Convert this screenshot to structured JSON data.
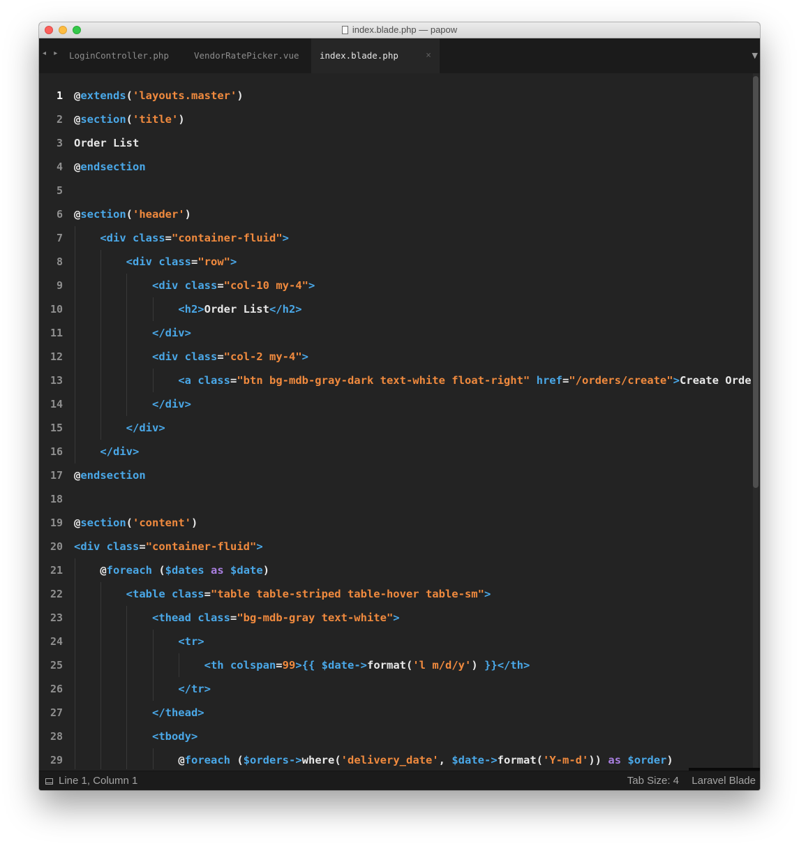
{
  "window": {
    "title": "index.blade.php — papow"
  },
  "tabs": [
    {
      "label": "LoginController.php",
      "active": false
    },
    {
      "label": "VendorRatePicker.vue",
      "active": false
    },
    {
      "label": "index.blade.php",
      "active": true
    }
  ],
  "tab_controls": {
    "nav_arrows": "◂ ▸",
    "close": "×",
    "menu": "▼"
  },
  "editor": {
    "current_line": 1,
    "lines": [
      {
        "n": "1",
        "tokens": [
          [
            "at",
            "@"
          ],
          [
            "dir",
            "extends"
          ],
          [
            "punct",
            "("
          ],
          [
            "str",
            "'layouts.master'"
          ],
          [
            "punct",
            ")"
          ]
        ]
      },
      {
        "n": "2",
        "tokens": [
          [
            "at",
            "@"
          ],
          [
            "dir",
            "section"
          ],
          [
            "punct",
            "("
          ],
          [
            "str",
            "'title'"
          ],
          [
            "punct",
            ")"
          ]
        ]
      },
      {
        "n": "3",
        "tokens": [
          [
            "text",
            "Order List"
          ]
        ]
      },
      {
        "n": "4",
        "tokens": [
          [
            "at",
            "@"
          ],
          [
            "dir",
            "endsection"
          ]
        ]
      },
      {
        "n": "5",
        "tokens": []
      },
      {
        "n": "6",
        "tokens": [
          [
            "at",
            "@"
          ],
          [
            "dir",
            "section"
          ],
          [
            "punct",
            "("
          ],
          [
            "str",
            "'header'"
          ],
          [
            "punct",
            ")"
          ]
        ]
      },
      {
        "n": "7",
        "tokens": [
          [
            "ws",
            "    "
          ],
          [
            "tag",
            "<div "
          ],
          [
            "attr",
            "class"
          ],
          [
            "punct",
            "="
          ],
          [
            "str",
            "\"container-fluid\""
          ],
          [
            "tag",
            ">"
          ]
        ]
      },
      {
        "n": "8",
        "tokens": [
          [
            "ws",
            "        "
          ],
          [
            "tag",
            "<div "
          ],
          [
            "attr",
            "class"
          ],
          [
            "punct",
            "="
          ],
          [
            "str",
            "\"row\""
          ],
          [
            "tag",
            ">"
          ]
        ]
      },
      {
        "n": "9",
        "tokens": [
          [
            "ws",
            "            "
          ],
          [
            "tag",
            "<div "
          ],
          [
            "attr",
            "class"
          ],
          [
            "punct",
            "="
          ],
          [
            "str",
            "\"col-10 my-4\""
          ],
          [
            "tag",
            ">"
          ]
        ]
      },
      {
        "n": "10",
        "tokens": [
          [
            "ws",
            "                "
          ],
          [
            "tag",
            "<h2>"
          ],
          [
            "text",
            "Order List"
          ],
          [
            "tag",
            "</h2>"
          ]
        ]
      },
      {
        "n": "11",
        "tokens": [
          [
            "ws",
            "            "
          ],
          [
            "tag",
            "</div>"
          ]
        ]
      },
      {
        "n": "12",
        "tokens": [
          [
            "ws",
            "            "
          ],
          [
            "tag",
            "<div "
          ],
          [
            "attr",
            "class"
          ],
          [
            "punct",
            "="
          ],
          [
            "str",
            "\"col-2 my-4\""
          ],
          [
            "tag",
            ">"
          ]
        ]
      },
      {
        "n": "13",
        "tokens": [
          [
            "ws",
            "                "
          ],
          [
            "tag",
            "<a "
          ],
          [
            "attr",
            "class"
          ],
          [
            "punct",
            "="
          ],
          [
            "str",
            "\"btn bg-mdb-gray-dark text-white float-right\""
          ],
          [
            "ws",
            " "
          ],
          [
            "attr",
            "href"
          ],
          [
            "punct",
            "="
          ],
          [
            "str",
            "\"/orders/create\""
          ],
          [
            "tag",
            ">"
          ],
          [
            "text",
            "Create Order</a>"
          ]
        ]
      },
      {
        "n": "14",
        "tokens": [
          [
            "ws",
            "            "
          ],
          [
            "tag",
            "</div>"
          ]
        ]
      },
      {
        "n": "15",
        "tokens": [
          [
            "ws",
            "        "
          ],
          [
            "tag",
            "</div>"
          ]
        ]
      },
      {
        "n": "16",
        "tokens": [
          [
            "ws",
            "    "
          ],
          [
            "tag",
            "</div>"
          ]
        ]
      },
      {
        "n": "17",
        "tokens": [
          [
            "at",
            "@"
          ],
          [
            "dir",
            "endsection"
          ]
        ]
      },
      {
        "n": "18",
        "tokens": []
      },
      {
        "n": "19",
        "tokens": [
          [
            "at",
            "@"
          ],
          [
            "dir",
            "section"
          ],
          [
            "punct",
            "("
          ],
          [
            "str",
            "'content'"
          ],
          [
            "punct",
            ")"
          ]
        ]
      },
      {
        "n": "20",
        "tokens": [
          [
            "tag",
            "<div "
          ],
          [
            "attr",
            "class"
          ],
          [
            "punct",
            "="
          ],
          [
            "str",
            "\"container-fluid\""
          ],
          [
            "tag",
            ">"
          ]
        ]
      },
      {
        "n": "21",
        "tokens": [
          [
            "ws",
            "    "
          ],
          [
            "at",
            "@"
          ],
          [
            "dir",
            "foreach"
          ],
          [
            "punct",
            " ("
          ],
          [
            "var",
            "$dates"
          ],
          [
            "ws",
            " "
          ],
          [
            "kw",
            "as"
          ],
          [
            "ws",
            " "
          ],
          [
            "var",
            "$date"
          ],
          [
            "punct",
            ")"
          ]
        ]
      },
      {
        "n": "22",
        "tokens": [
          [
            "ws",
            "        "
          ],
          [
            "tag",
            "<table "
          ],
          [
            "attr",
            "class"
          ],
          [
            "punct",
            "="
          ],
          [
            "str",
            "\"table table-striped table-hover table-sm\""
          ],
          [
            "tag",
            ">"
          ]
        ]
      },
      {
        "n": "23",
        "tokens": [
          [
            "ws",
            "            "
          ],
          [
            "tag",
            "<thead "
          ],
          [
            "attr",
            "class"
          ],
          [
            "punct",
            "="
          ],
          [
            "str",
            "\"bg-mdb-gray text-white\""
          ],
          [
            "tag",
            ">"
          ]
        ]
      },
      {
        "n": "24",
        "tokens": [
          [
            "ws",
            "                "
          ],
          [
            "tag",
            "<tr>"
          ]
        ]
      },
      {
        "n": "25",
        "tokens": [
          [
            "ws",
            "                    "
          ],
          [
            "tag",
            "<th "
          ],
          [
            "attr",
            "colspan"
          ],
          [
            "punct",
            "="
          ],
          [
            "num",
            "99"
          ],
          [
            "tag",
            ">"
          ],
          [
            "brace",
            "{{ "
          ],
          [
            "var",
            "$date"
          ],
          [
            "brace",
            "->"
          ],
          [
            "fn",
            "format"
          ],
          [
            "punct",
            "("
          ],
          [
            "str",
            "'l m/d/y'"
          ],
          [
            "punct",
            ") "
          ],
          [
            "brace",
            "}}"
          ],
          [
            "tag",
            "</th>"
          ]
        ]
      },
      {
        "n": "26",
        "tokens": [
          [
            "ws",
            "                "
          ],
          [
            "tag",
            "</tr>"
          ]
        ]
      },
      {
        "n": "27",
        "tokens": [
          [
            "ws",
            "            "
          ],
          [
            "tag",
            "</thead>"
          ]
        ]
      },
      {
        "n": "28",
        "tokens": [
          [
            "ws",
            "            "
          ],
          [
            "tag",
            "<tbody>"
          ]
        ]
      },
      {
        "n": "29",
        "tokens": [
          [
            "ws",
            "                "
          ],
          [
            "at",
            "@"
          ],
          [
            "dir",
            "foreach"
          ],
          [
            "punct",
            " ("
          ],
          [
            "var",
            "$orders"
          ],
          [
            "brace",
            "->"
          ],
          [
            "fn",
            "where"
          ],
          [
            "punct",
            "("
          ],
          [
            "str",
            "'delivery_date'"
          ],
          [
            "punct",
            ", "
          ],
          [
            "var",
            "$date"
          ],
          [
            "brace",
            "->"
          ],
          [
            "fn",
            "format"
          ],
          [
            "punct",
            "("
          ],
          [
            "str",
            "'Y-m-d'"
          ],
          [
            "punct",
            "))"
          ],
          [
            "ws",
            " "
          ],
          [
            "kw",
            "as"
          ],
          [
            "ws",
            " "
          ],
          [
            "var",
            "$order"
          ],
          [
            "punct",
            ")"
          ]
        ]
      }
    ]
  },
  "status": {
    "position": "Line 1, Column 1",
    "tab_size": "Tab Size: 4",
    "syntax": "Laravel Blade"
  }
}
